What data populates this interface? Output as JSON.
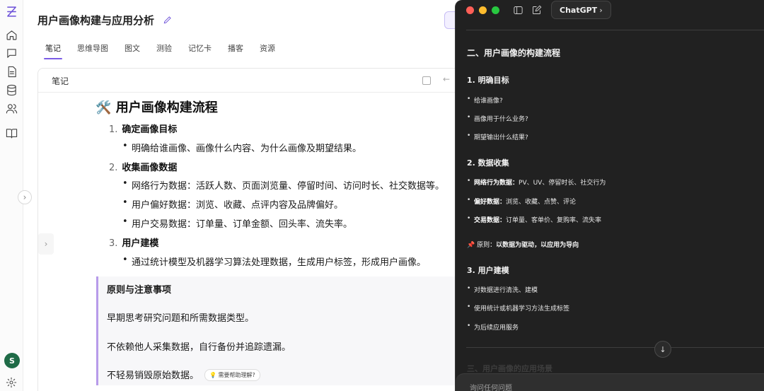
{
  "header": {
    "title": "用户画像构建与应用分析"
  },
  "tabs": [
    {
      "label": "笔记"
    },
    {
      "label": "思维导图"
    },
    {
      "label": "图文"
    },
    {
      "label": "测验"
    },
    {
      "label": "记忆卡"
    },
    {
      "label": "播客"
    },
    {
      "label": "资源"
    }
  ],
  "note": {
    "card_label": "笔记",
    "heading_emoji": "🛠️",
    "heading": "用户画像构建流程",
    "sections": [
      {
        "num": "1.",
        "title": "确定画像目标",
        "items": [
          "明确给谁画像、画像什么内容、为什么画像及期望结果。"
        ]
      },
      {
        "num": "2.",
        "title": "收集画像数据",
        "items": [
          "网络行为数据：活跃人数、页面浏览量、停留时间、访问时长、社交数据等。",
          "用户偏好数据：浏览、收藏、点评内容及品牌偏好。",
          "用户交易数据：订单量、订单金额、回头率、流失率。"
        ]
      },
      {
        "num": "3.",
        "title": "用户建模",
        "items": [
          "通过统计模型及机器学习算法处理数据，生成用户标签，形成用户画像。"
        ]
      }
    ],
    "callout": {
      "title": "原则与注意事项",
      "lines": [
        "早期思考研究问题和所需数据类型。",
        "不依赖他人采集数据，自行备份并追踪遗漏。",
        "不轻易销毁原始数据。"
      ],
      "help_chip": "💡 需要帮助理解?"
    }
  },
  "user": {
    "avatar_letter": "S"
  },
  "chatgpt": {
    "app_label": "ChatGPT",
    "section_title": "二、用户画像的构建流程",
    "step1": {
      "title": "1. 明确目标",
      "items": [
        "给谁画像?",
        "画像用于什么业务?",
        "期望输出什么结果?"
      ]
    },
    "step2": {
      "title": "2. 数据收集",
      "items": [
        {
          "bold": "网络行为数据：",
          "text": "PV、UV、停留时长、社交行为"
        },
        {
          "bold": "偏好数据：",
          "text": "浏览、收藏、点赞、评论"
        },
        {
          "bold": "交易数据：",
          "text": "订单量、客单价、复购率、流失率"
        }
      ]
    },
    "principle": {
      "emoji": "📌",
      "label": "原则：",
      "text": "以数据为驱动，以应用为导向"
    },
    "step3": {
      "title": "3. 用户建模",
      "items": [
        "对数据进行清洗、建模",
        "使用统计或机器学习方法生成标签",
        "为后续应用服务"
      ]
    },
    "next_section_faded": "三、用户画像的应用场景",
    "composer_placeholder": "询问任何问题"
  },
  "colors": {
    "accent": "#7b5ce6",
    "gpt_bg": "#212121"
  }
}
